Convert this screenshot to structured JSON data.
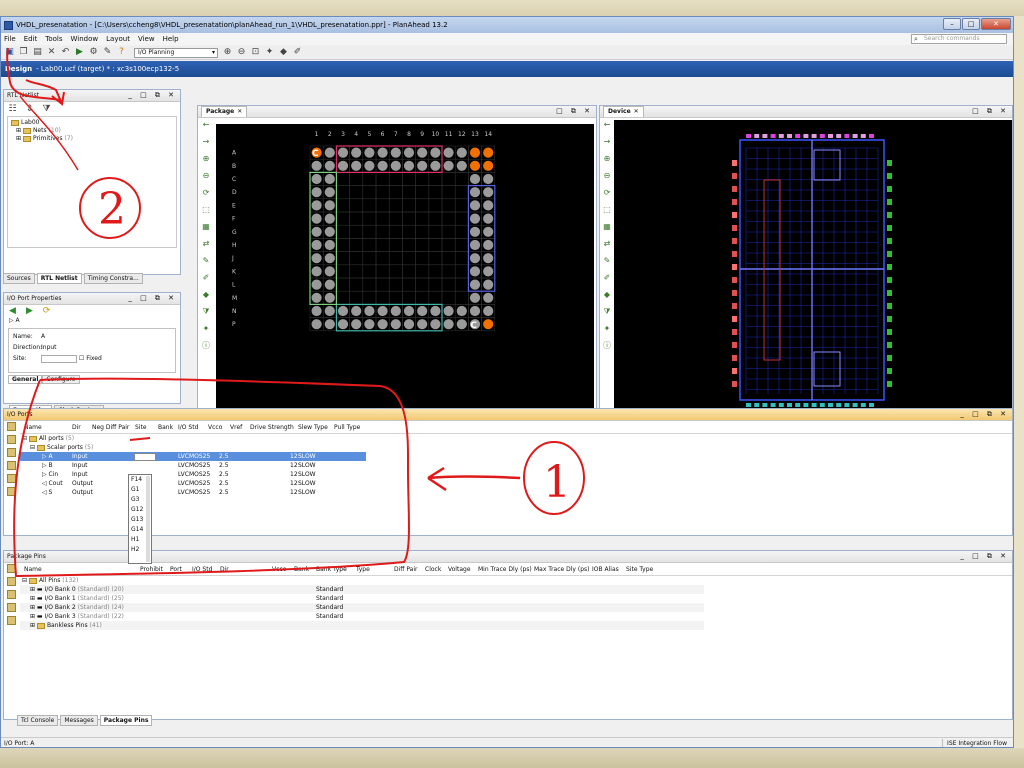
{
  "window": {
    "title": "VHDL_presenatation - [C:\\Users\\ccheng8\\VHDL_presenatation\\planAhead_run_1\\VHDL_presenatation.ppr] - PlanAhead 13.2",
    "min": "–",
    "max": "□",
    "close": "✕"
  },
  "menu": [
    "File",
    "Edit",
    "Tools",
    "Window",
    "Layout",
    "View",
    "Help"
  ],
  "search": {
    "placeholder": "Search commands"
  },
  "toolbar": {
    "layout_select": "I/O Planning"
  },
  "design_bar": {
    "label": "Design",
    "target": "- Lab00.ucf (target) * : xc3s100ecp132-5"
  },
  "rtl_netlist": {
    "title": "RTL Netlist",
    "tree": [
      {
        "label": "Lab00",
        "count": ""
      },
      {
        "label": "Nets",
        "count": "(10)"
      },
      {
        "label": "Primitives",
        "count": "(7)"
      }
    ],
    "tabs": [
      "Sources",
      "RTL Netlist",
      "Timing Constra..."
    ]
  },
  "io_port_properties": {
    "title": "I/O Port Properties",
    "port": "A",
    "name_label": "Name:",
    "name_value": "A",
    "direction_label": "Direction:",
    "direction_value": "Input",
    "site_label": "Site:",
    "fixed_label": "Fixed",
    "subtabs": [
      "General",
      "Configure"
    ],
    "bottom_tabs": [
      "Properties",
      "Clock Regions"
    ]
  },
  "package": {
    "title": "Package",
    "columns": [
      "1",
      "2",
      "3",
      "4",
      "5",
      "6",
      "7",
      "8",
      "9",
      "10",
      "11",
      "12",
      "13",
      "14"
    ],
    "rows": [
      "A",
      "B",
      "C",
      "D",
      "E",
      "F",
      "G",
      "H",
      "J",
      "K",
      "L",
      "M",
      "N",
      "P"
    ],
    "corner_labels": [
      "C",
      "C"
    ]
  },
  "device": {
    "title": "Device"
  },
  "io_ports": {
    "title": "I/O Ports",
    "columns": [
      "Name",
      "Dir",
      "Neg Diff Pair",
      "Site",
      "Bank",
      "I/O Std",
      "Vcco",
      "Vref",
      "Drive Strength",
      "Slew Type",
      "Pull Type"
    ],
    "groups": [
      {
        "label": "All ports",
        "count": "(5)"
      },
      {
        "label": "Scalar ports",
        "count": "(5)"
      }
    ],
    "rows": [
      {
        "name": "A",
        "dir": "Input",
        "iostd": "LVCMOS25",
        "vcco": "2.5",
        "drive": "12",
        "slew": "SLOW"
      },
      {
        "name": "B",
        "dir": "Input",
        "iostd": "LVCMOS25",
        "vcco": "2.5",
        "drive": "12",
        "slew": "SLOW"
      },
      {
        "name": "Cin",
        "dir": "Input",
        "iostd": "LVCMOS25",
        "vcco": "2.5",
        "drive": "12",
        "slew": "SLOW"
      },
      {
        "name": "Cout",
        "dir": "Output",
        "iostd": "LVCMOS25",
        "vcco": "2.5",
        "drive": "12",
        "slew": "SLOW"
      },
      {
        "name": "S",
        "dir": "Output",
        "iostd": "LVCMOS25",
        "vcco": "2.5",
        "drive": "12",
        "slew": "SLOW"
      }
    ],
    "site_options": [
      "F14",
      "G1",
      "G3",
      "G12",
      "G13",
      "G14",
      "H1",
      "H2"
    ]
  },
  "package_pins": {
    "title": "Package Pins",
    "columns": [
      "Name",
      "Prohibit",
      "Port",
      "I/O Std",
      "Dir",
      "Vcco",
      "Bank",
      "Bank Type",
      "Type",
      "Diff Pair",
      "Clock",
      "Voltage",
      "Min Trace Dly (ps)",
      "Max Trace Dly (ps)",
      "IOB Alias",
      "Site Type"
    ],
    "all_pins": {
      "label": "All Pins",
      "count": "(132)"
    },
    "banks": [
      {
        "label": "I/O Bank 0",
        "count": "(Standard) (20)",
        "type": "Standard"
      },
      {
        "label": "I/O Bank 1",
        "count": "(Standard) (25)",
        "type": "Standard"
      },
      {
        "label": "I/O Bank 2",
        "count": "(Standard) (24)",
        "type": "Standard"
      },
      {
        "label": "I/O Bank 3",
        "count": "(Standard) (22)",
        "type": "Standard"
      }
    ],
    "bankless": {
      "label": "Bankless Pins",
      "count": "(41)"
    }
  },
  "bottom_tabs": [
    "Tcl Console",
    "Messages",
    "Package Pins"
  ],
  "status": {
    "left": "I/O Port: A",
    "right": "ISE Integration Flow"
  },
  "annotations": {
    "one": "1",
    "two": "2"
  }
}
